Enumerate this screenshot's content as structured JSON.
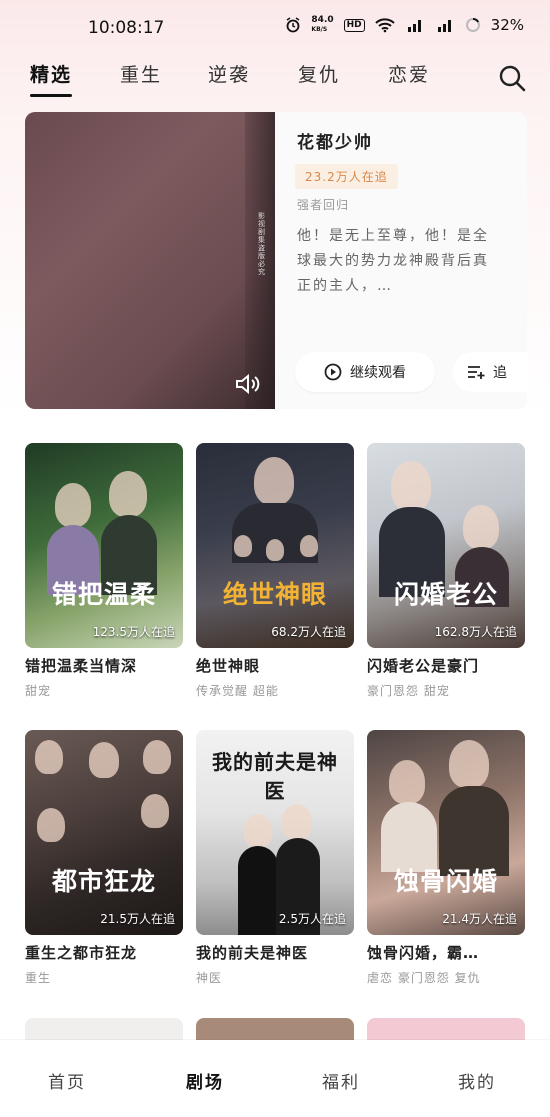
{
  "status": {
    "time": "10:08:17",
    "speed": "84.0",
    "speed_unit": "KB/S",
    "hd": "HD",
    "battery": "32%"
  },
  "tabs": [
    {
      "label": "精选",
      "active": true
    },
    {
      "label": "重生",
      "active": false
    },
    {
      "label": "逆袭",
      "active": false
    },
    {
      "label": "复仇",
      "active": false
    },
    {
      "label": "恋爱",
      "active": false
    }
  ],
  "hero": {
    "title": "花都少帅",
    "viewers": "23.2万人在追",
    "genre": "强者回归",
    "description": "他！是无上至尊，他！是全球最大的势力龙神殿背后真正的主人，…",
    "continue_label": "继续观看",
    "follow_label": "追",
    "watermark": "影视剧集 盗版必究"
  },
  "dramas": [
    {
      "poster_title": "错把温柔",
      "viewers": "123.5万人在追",
      "name": "错把温柔当情深",
      "tags": "甜宠",
      "title_color": "#ffffff"
    },
    {
      "poster_title": "绝世神眼",
      "viewers": "68.2万人在追",
      "name": "绝世神眼",
      "tags": "传承觉醒 超能",
      "title_color": "#f2b233"
    },
    {
      "poster_title": "闪婚老公",
      "viewers": "162.8万人在追",
      "name": "闪婚老公是豪门",
      "tags": "豪门恩怨 甜宠",
      "title_color": "#ffffff"
    },
    {
      "poster_title": "都市狂龙",
      "viewers": "21.5万人在追",
      "name": "重生之都市狂龙",
      "tags": "重生",
      "title_color": "#ffffff"
    },
    {
      "poster_title": "我的前夫是神医",
      "viewers": "2.5万人在追",
      "name": "我的前夫是神医",
      "tags": "神医",
      "title_color": "#1a1a1a"
    },
    {
      "poster_title": "蚀骨闪婚",
      "viewers": "21.4万人在追",
      "name": "蚀骨闪婚，霸…",
      "tags": "虐恋 豪门恩怨 复仇",
      "title_color": "#ffffff"
    }
  ],
  "nav": [
    {
      "label": "首页",
      "active": false
    },
    {
      "label": "剧场",
      "active": true
    },
    {
      "label": "福利",
      "active": false
    },
    {
      "label": "我的",
      "active": false
    }
  ],
  "colors": {
    "accent_badge": "#d8884c",
    "badge_bg": "#fbeee2",
    "header_bg": "#fbe9ea"
  }
}
